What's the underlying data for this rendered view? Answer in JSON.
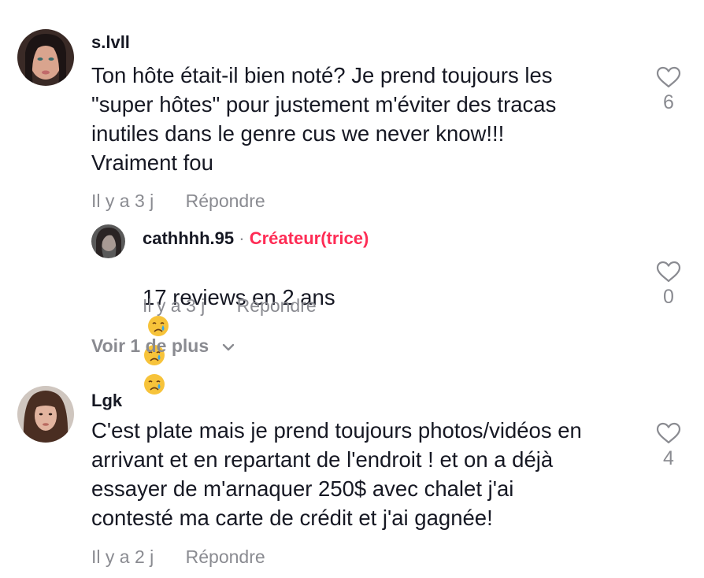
{
  "comments": [
    {
      "username": "s.lvll",
      "text": "Ton hôte était-il bien noté? Je prend toujours les\n\"super hôtes\" pour justement m'éviter des tracas\ninutiles dans le genre cus we never know!!!\nVraiment fou",
      "time": "Il y a 3 j",
      "reply_label": "Répondre",
      "likes": "6",
      "replies": [
        {
          "username": "cathhhh.95",
          "separator": "·",
          "badge": "Créateur(trice)",
          "text": "17 reviews en 2 ans",
          "emojis": [
            "crying-face",
            "crying-face",
            "crying-face"
          ],
          "time": "Il y a 3 j",
          "reply_label": "Répondre",
          "likes": "0"
        }
      ],
      "more_replies_label": "Voir 1 de plus"
    },
    {
      "username": "Lgk",
      "text": "C'est plate mais je prend toujours photos/vidéos en\narrivant et en repartant de l'endroit ! et on a déjà\nessayer de m'arnaquer 250$ avec chalet j'ai\ncontesté ma carte de crédit et j'ai gagnée!",
      "time": "Il y a 2 j",
      "reply_label": "Répondre",
      "likes": "4"
    }
  ],
  "colors": {
    "text_primary": "#161823",
    "text_secondary": "#8a8b91",
    "creator_accent": "#fe2c55"
  },
  "icons": [
    "heart-outline-icon",
    "chevron-down-icon",
    "crying-face-emoji"
  ]
}
